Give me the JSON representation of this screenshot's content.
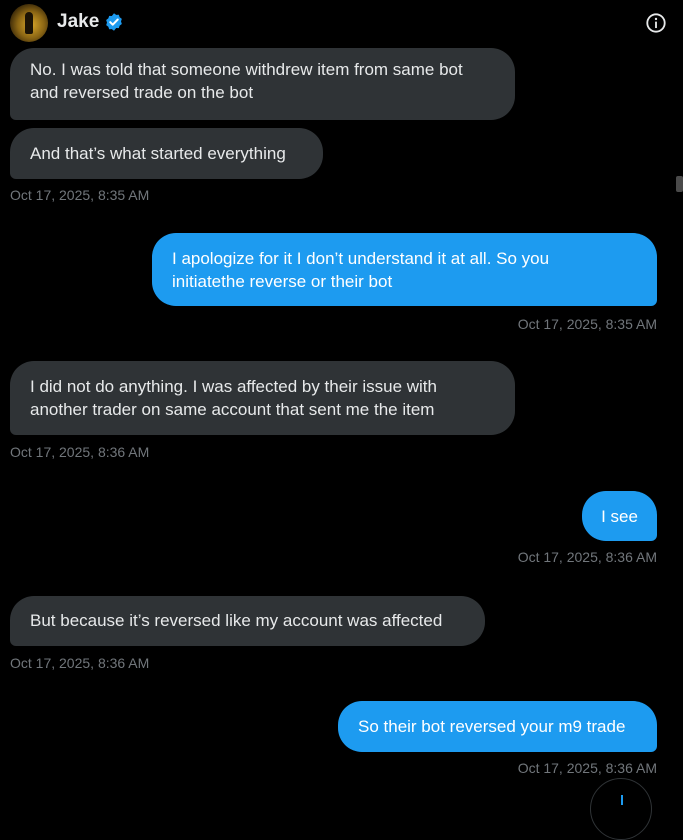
{
  "header": {
    "name": "Jake",
    "verified_color": "#1d9bf0",
    "avatar_icon": "avatar-image",
    "info_icon": "info-icon"
  },
  "colors": {
    "incoming_bubble": "#2f3336",
    "outgoing_bubble": "#1d9bf0",
    "timestamp": "#71767b"
  },
  "messages": [
    {
      "direction": "in",
      "lines": [
        "No. I was told that someone withdrew item from same bot",
        "and reversed trade on the bot"
      ]
    },
    {
      "direction": "in",
      "lines": [
        "And that’s what started everything"
      ],
      "timestamp": "Oct 17, 2025, 8:35 AM"
    },
    {
      "direction": "out",
      "lines": [
        "I apologize for it I don’t understand it at all. So you",
        "initiatethe reverse or their bot"
      ],
      "timestamp": "Oct 17, 2025, 8:35 AM"
    },
    {
      "direction": "in",
      "lines": [
        "I did not do anything. I was affected by their issue with",
        "another trader on same account that sent me the item"
      ],
      "timestamp": "Oct 17, 2025, 8:36 AM"
    },
    {
      "direction": "out",
      "lines": [
        "I see"
      ],
      "timestamp": "Oct 17, 2025, 8:36 AM"
    },
    {
      "direction": "in",
      "lines": [
        "But because it’s reversed like my account was affected"
      ],
      "timestamp": "Oct 17, 2025, 8:36 AM"
    },
    {
      "direction": "out",
      "lines": [
        "So their bot reversed your m9 trade"
      ],
      "timestamp": "Oct 17, 2025, 8:36 AM"
    }
  ]
}
